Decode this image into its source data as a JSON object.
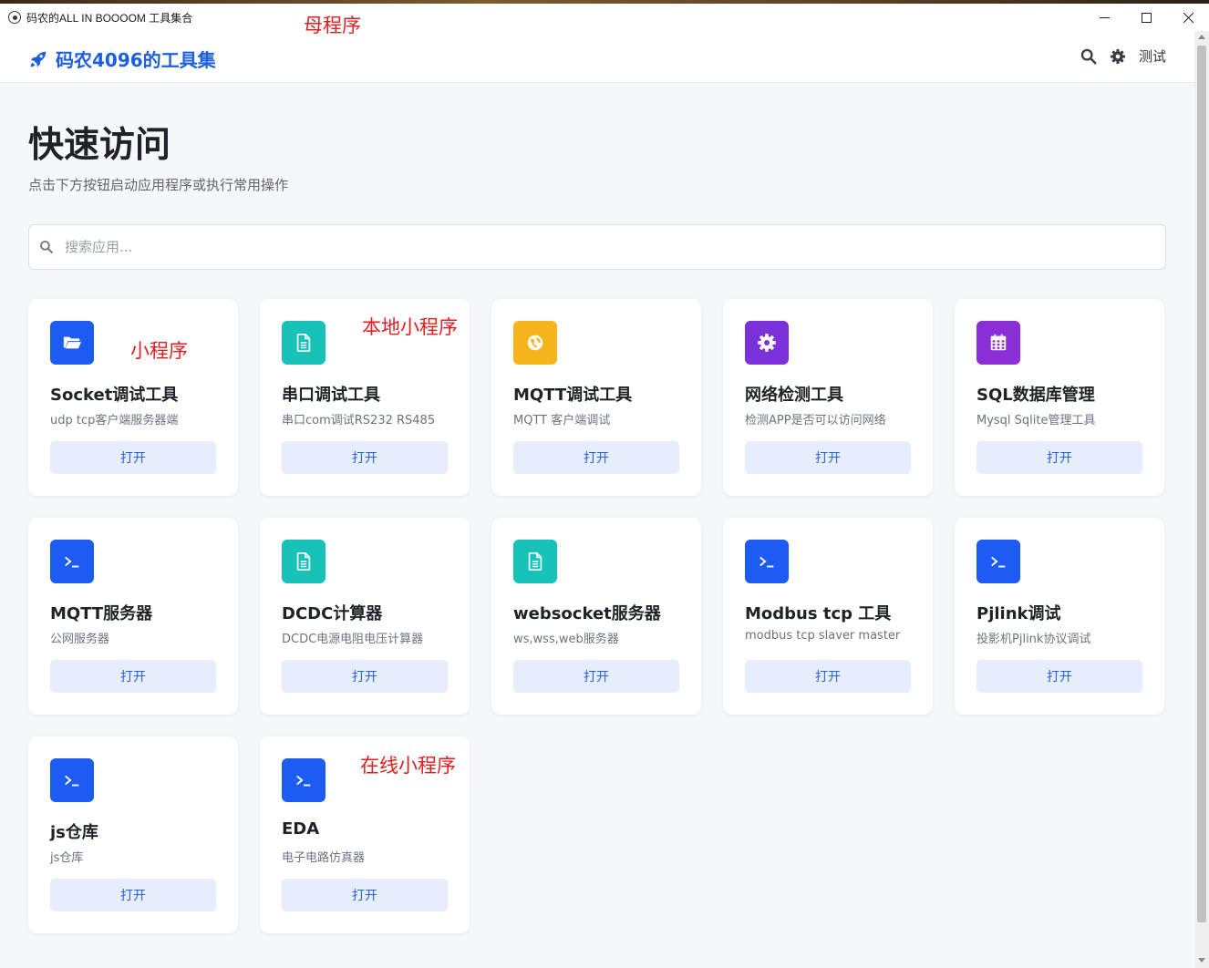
{
  "window": {
    "title": "码农的ALL IN BOOOOM 工具集合",
    "minimize": "—",
    "maximize": "☐",
    "close": "✕"
  },
  "annotations": {
    "parent": "母程序",
    "mini": "小程序",
    "local": "本地小程序",
    "online": "在线小程序"
  },
  "header": {
    "brand": "码农4096的工具集",
    "test_label": "测试"
  },
  "page": {
    "title": "快速访问",
    "subtitle": "点击下方按钮启动应用程序或执行常用操作"
  },
  "search": {
    "placeholder": "搜索应用..."
  },
  "colors": {
    "blue": "#1c5cf2",
    "teal": "#18c2b8",
    "amber": "#f6b41d",
    "purple": "#7b31d9",
    "violet": "#8a2fd6"
  },
  "cards": [
    {
      "title": "Socket调试工具",
      "desc": "udp tcp客户端服务器端",
      "button": "打开",
      "icon": "folder-open-icon",
      "color": "#1c5cf2"
    },
    {
      "title": "串口调试工具",
      "desc": "串口com调试RS232 RS485",
      "button": "打开",
      "icon": "file-icon",
      "color": "#18c2b8"
    },
    {
      "title": "MQTT调试工具",
      "desc": "MQTT 客户端调试",
      "button": "打开",
      "icon": "globe-icon",
      "color": "#f6b41d"
    },
    {
      "title": "网络检测工具",
      "desc": "检测APP是否可以访问网络",
      "button": "打开",
      "icon": "gear-icon",
      "color": "#7b31d9"
    },
    {
      "title": "SQL数据库管理",
      "desc": "Mysql Sqlite管理工具",
      "button": "打开",
      "icon": "calendar-icon",
      "color": "#8a2fd6"
    },
    {
      "title": "MQTT服务器",
      "desc": "公网服务器",
      "button": "打开",
      "icon": "terminal-icon",
      "color": "#1c5cf2"
    },
    {
      "title": "DCDC计算器",
      "desc": "DCDC电源电阻电压计算器",
      "button": "打开",
      "icon": "file-icon",
      "color": "#18c2b8"
    },
    {
      "title": "websocket服务器",
      "desc": "ws,wss,web服务器",
      "button": "打开",
      "icon": "file-icon",
      "color": "#18c2b8"
    },
    {
      "title": "Modbus tcp 工具",
      "desc": "modbus tcp slaver master",
      "button": "打开",
      "icon": "terminal-icon",
      "color": "#1c5cf2"
    },
    {
      "title": "Pjlink调试",
      "desc": "投影机Pjlink协议调试",
      "button": "打开",
      "icon": "terminal-icon",
      "color": "#1c5cf2"
    },
    {
      "title": "js仓库",
      "desc": "js仓库",
      "button": "打开",
      "icon": "terminal-icon",
      "color": "#1c5cf2"
    },
    {
      "title": "EDA",
      "desc": "电子电路仿真器",
      "button": "打开",
      "icon": "terminal-icon",
      "color": "#1c5cf2"
    }
  ]
}
